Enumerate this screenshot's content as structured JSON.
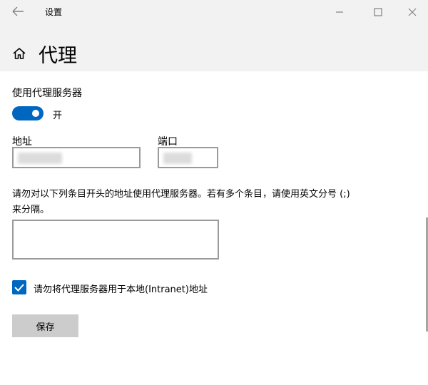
{
  "window": {
    "title": "设置",
    "back_icon": "arrow-left-icon",
    "minimize_icon": "minimize-icon",
    "maximize_icon": "maximize-icon",
    "close_icon": "close-icon"
  },
  "header": {
    "home_icon": "home-icon",
    "title": "代理"
  },
  "proxy": {
    "use_proxy_label": "使用代理服务器",
    "toggle_state_label": "开",
    "toggle_on": true,
    "accent_color": "#0067c0",
    "address_label": "地址",
    "address_value": "",
    "port_label": "端口",
    "port_value": "",
    "exceptions_description": "请勿对以下列条目开头的地址使用代理服务器。若有多个条目，请使用英文分号 (;) 来分隔。",
    "exceptions_value": "",
    "bypass_local_label": "请勿将代理服务器用于本地(Intranet)地址",
    "bypass_local_checked": true,
    "save_label": "保存"
  }
}
